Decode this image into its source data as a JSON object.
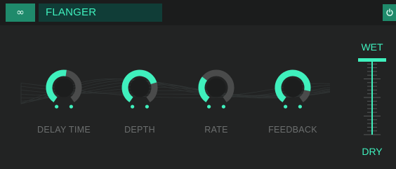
{
  "header": {
    "link_icon": "link-icon",
    "preset_name": "FLANGER",
    "power_icon": "power-icon"
  },
  "knobs": [
    {
      "label": "DELAY TIME",
      "value": 0.53
    },
    {
      "label": "DEPTH",
      "value": 0.75
    },
    {
      "label": "RATE",
      "value": 0.32
    },
    {
      "label": "FEEDBACK",
      "value": 0.85
    }
  ],
  "mix": {
    "wet_label": "WET",
    "dry_label": "DRY",
    "value": 1.0
  },
  "colors": {
    "accent": "#3ff0bd",
    "accent_dark": "#1f8a6b",
    "knob_track": "#4a4b4b",
    "background": "#222323"
  }
}
